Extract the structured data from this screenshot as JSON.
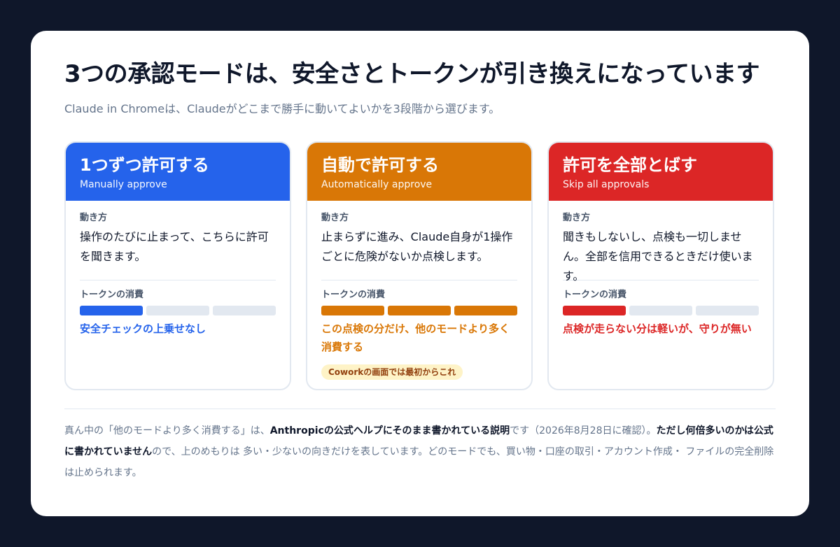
{
  "header": {
    "title": "3つの承認モードは、安全さとトークンが引き換えになっています",
    "subtitle": "Claude in Chromeは、Claudeがどこまで勝手に動いてよいかを3段階から選びます。"
  },
  "colors": {
    "blue": "#2563eb",
    "orange": "#d97706",
    "red": "#dc2626",
    "empty_bar": "#e2e8f0",
    "background": "#0f172a"
  },
  "cards": [
    {
      "title": "1つずつ許可する",
      "subtitle_en": "Manually approve",
      "how_label": "動き方",
      "description": "操作のたびに止まって、こちらに許可を聞きます。",
      "token_label": "トークンの消費",
      "token_level": 1,
      "token_max": 3,
      "note": "安全チェックの上乗せなし"
    },
    {
      "title": "自動で許可する",
      "subtitle_en": "Automatically approve",
      "how_label": "動き方",
      "description": "止まらずに進み、Claude自身が1操作ごとに危険がないか点検します。",
      "token_label": "トークンの消費",
      "token_level": 3,
      "token_max": 3,
      "note": "この点検の分だけ、他のモードより多く消費する",
      "badge": "Coworkの画面では最初からこれ"
    },
    {
      "title": "許可を全部とばす",
      "subtitle_en": "Skip all approvals",
      "how_label": "動き方",
      "description": "聞きもしないし、点検も一切しません。全部を信用できるときだけ使います。",
      "token_label": "トークンの消費",
      "token_level": 1,
      "token_max": 3,
      "note": "点検が走らない分は軽いが、守りが無い"
    }
  ],
  "footer": {
    "part1": "真ん中の「他のモードより多く消費する」は、",
    "bold1": "Anthropicの公式ヘルプにそのまま書かれている説明",
    "part2": "です（2026年8月28日に確認）。",
    "bold2": "ただし何倍多いのかは公式に書かれていません",
    "part3": "ので、上のめもりは 多い・少ないの向きだけを表しています。どのモードでも、買い物・口座の取引・アカウント作成・ ファイルの完全削除は止められます。"
  }
}
